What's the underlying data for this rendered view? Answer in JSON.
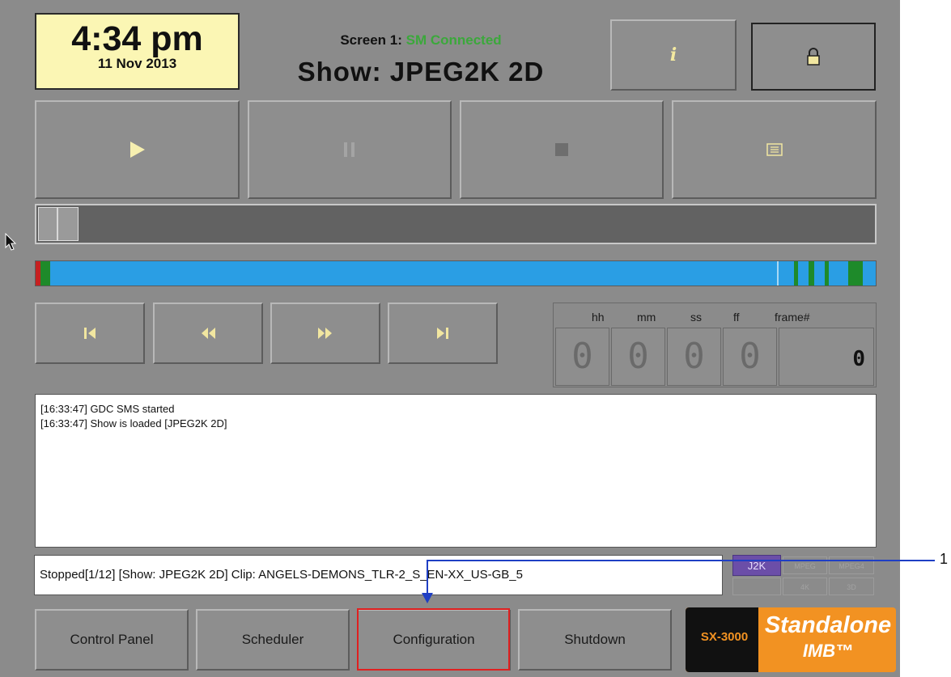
{
  "clock": {
    "time": "4:34 pm",
    "date": "11 Nov 2013"
  },
  "header": {
    "screen_label": "Screen 1:",
    "connection_status": "SM Connected",
    "show_title": "Show: JPEG2K 2D"
  },
  "toolbar": {
    "info_icon": "info-icon",
    "lock_icon": "lock-icon"
  },
  "transport": {
    "play_icon": "play-icon",
    "pause_icon": "pause-icon",
    "stop_icon": "stop-icon",
    "playlist_icon": "playlist-icon"
  },
  "navigation": {
    "skip_start_icon": "skip-to-start-icon",
    "rewind_icon": "rewind-icon",
    "fast_forward_icon": "fast-forward-icon",
    "skip_end_icon": "skip-to-end-icon"
  },
  "timecode": {
    "headers": [
      "hh",
      "mm",
      "ss",
      "ff",
      "frame#"
    ],
    "digits": [
      "0",
      "0",
      "0",
      "0"
    ],
    "frame": "0"
  },
  "log": {
    "lines": [
      "[16:33:47] GDC SMS started",
      "[16:33:47] Show is loaded [JPEG2K 2D]"
    ]
  },
  "status_bar": {
    "text": "Stopped[1/12] [Show: JPEG2K 2D] Clip: ANGELS-DEMONS_TLR-2_S_EN-XX_US-GB_5"
  },
  "format_badges": {
    "active": "J2K",
    "inactive": [
      "MPEG",
      "MPEG4",
      "",
      "4K",
      "3D"
    ]
  },
  "bottom_nav": {
    "control_panel": "Control Panel",
    "scheduler": "Scheduler",
    "configuration": "Configuration",
    "shutdown": "Shutdown"
  },
  "brand": {
    "model": "SX-3000",
    "name_line1": "Standalone",
    "name_line2": "IMB™"
  },
  "annotation": {
    "callout_number": "1"
  },
  "colors": {
    "panel": "#8b8b8b",
    "clock_bg": "#fbf6b4",
    "connected": "#3ba83b",
    "progress_blue": "#2a9ee4",
    "highlight": "#e02020",
    "callout": "#1f3fc4",
    "brand_orange": "#f29222"
  }
}
